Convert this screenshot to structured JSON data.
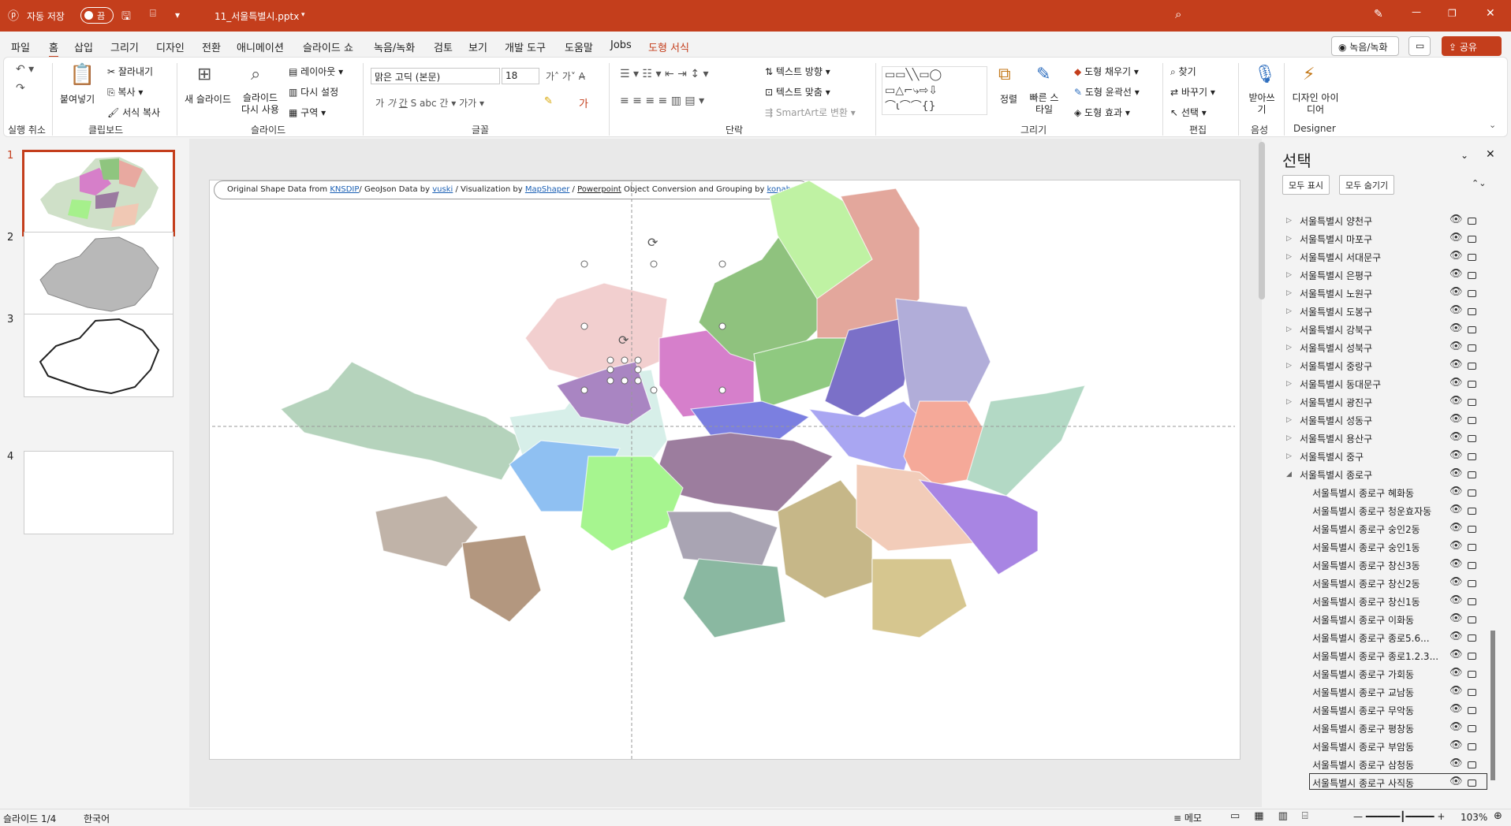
{
  "titlebar": {
    "autosave_label": "자동 저장",
    "toggle": "끔",
    "filename": "11_서울특별시.pptx"
  },
  "menu": [
    "파일",
    "홈",
    "삽입",
    "그리기",
    "디자인",
    "전환",
    "애니메이션",
    "슬라이드 쇼",
    "녹음/녹화",
    "검토",
    "보기",
    "개발 도구",
    "도움말",
    "Jobs",
    "도형 서식"
  ],
  "menu_right": {
    "record": "녹음/녹화",
    "share": "공유"
  },
  "ribbon": {
    "undo_group": "실행 취소",
    "paste": "붙여넣기",
    "cut": "잘라내기",
    "copy": "복사",
    "format_copy": "서식 복사",
    "clipboard_group": "클립보드",
    "new_slide": "새 슬라이드",
    "reuse_slide": "슬라이드 다시 사용",
    "layout": "레이아웃",
    "reset": "다시 설정",
    "section": "구역",
    "slides_group": "슬라이드",
    "font_name": "맑은 고딕 (본문)",
    "font_size": "18",
    "font_group": "글꼴",
    "text_direction": "텍스트 방향",
    "align_text": "텍스트 맞춤",
    "smartart": "SmartArt로 변환",
    "paragraph_group": "단락",
    "arrange": "정렬",
    "quick_styles": "빠른 스타일",
    "shape_fill": "도형 채우기",
    "shape_outline": "도형 윤곽선",
    "shape_effects": "도형 효과",
    "drawing_group": "그리기",
    "find": "찾기",
    "replace": "바꾸기",
    "select": "선택",
    "editing_group": "편집",
    "dictate": "받아쓰기",
    "voice_group": "음성",
    "design_ideas": "디자인 아이디어",
    "designer_group": "Designer"
  },
  "thumbs": [
    "1",
    "2",
    "3",
    "4"
  ],
  "slide": {
    "credit": {
      "prefix": "Original Shape Data from ",
      "knsdip": "KNSDIP",
      "mid1": "/ GeoJson Data by ",
      "vuski": "vuski",
      "mid2": " / Visualization  by ",
      "mapshaper": "MapShaper",
      "mid3": " / ",
      "ppt": "Powerpoint",
      "mid4": " Object Conversion and Grouping  by ",
      "konahn": "konahn"
    }
  },
  "pane": {
    "title": "선택",
    "show_all": "모두 표시",
    "hide_all": "모두 숨기기",
    "items": [
      "서울특별시 양천구",
      "서울특별시 마포구",
      "서울특별시 서대문구",
      "서울특별시 은평구",
      "서울특별시 노원구",
      "서울특별시 도봉구",
      "서울특별시 강북구",
      "서울특별시 성북구",
      "서울특별시 중랑구",
      "서울특별시 동대문구",
      "서울특별시 광진구",
      "서울특별시 성동구",
      "서울특별시 용산구",
      "서울특별시 중구",
      "서울특별시 종로구"
    ],
    "children": [
      "서울특별시 종로구 혜화동",
      "서울특별시 종로구 청운효자동",
      "서울특별시 종로구 숭인2동",
      "서울특별시 종로구 숭인1동",
      "서울특별시 종로구 창신3동",
      "서울특별시 종로구 창신2동",
      "서울특별시 종로구 창신1동",
      "서울특별시 종로구 이화동",
      "서울특별시 종로구 종로5.6...",
      "서울특별시 종로구 종로1.2.3...",
      "서울특별시 종로구 가회동",
      "서울특별시 종로구 교남동",
      "서울특별시 종로구 무악동",
      "서울특별시 종로구 평창동",
      "서울특별시 종로구 부암동",
      "서울특별시 종로구 삼청동",
      "서울특별시 종로구 사직동"
    ]
  },
  "status": {
    "slide": "슬라이드 1/4",
    "lang": "한국어",
    "notes": "메모",
    "zoom": "103%"
  },
  "colors": {
    "accent": "#c43e1c"
  }
}
